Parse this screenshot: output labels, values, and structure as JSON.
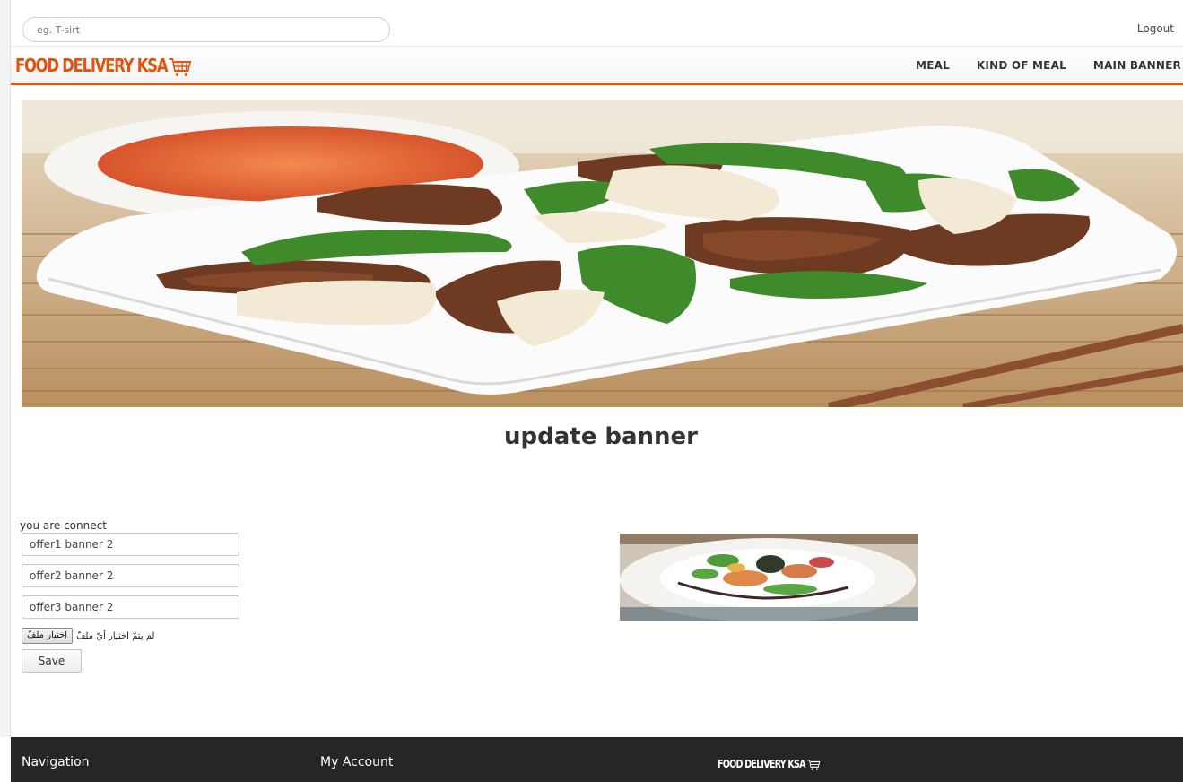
{
  "header": {
    "search_placeholder": "eg. T-sirt",
    "logout_label": "Logout"
  },
  "nav": {
    "brand": "FOOD DELIVERY KSA",
    "links": [
      "MEAL",
      "KIND OF MEAL",
      "MAIN BANNER"
    ]
  },
  "main": {
    "title": "update banner",
    "status": "you are connect",
    "fields": [
      "offer1 banner 2",
      "offer2 banner 2",
      "offer3 banner 2"
    ],
    "file_button_label": "اختيار ملفّ",
    "file_status": "لم يتمّ اختيار أيّ ملفّ",
    "save_label": "Save"
  },
  "footer": {
    "navigation_heading": "Navigation",
    "account_heading": "My Account",
    "brand": "FOOD DELIVERY KSA"
  },
  "colors": {
    "accent": "#e2530f",
    "footer_bg": "#262626"
  },
  "icons": {
    "brand_cart": "shopping-cart-icon"
  }
}
